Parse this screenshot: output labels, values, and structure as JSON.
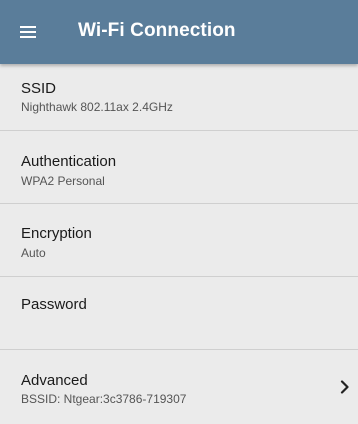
{
  "appbar": {
    "menu_icon": "hamburger-menu-icon",
    "title": "Wi-Fi Connection",
    "color": "#5a7d9a"
  },
  "settings": {
    "ssid": {
      "label": "SSID",
      "value": "Nighthawk 802.11ax 2.4GHz"
    },
    "authentication": {
      "label": "Authentication",
      "value": "WPA2 Personal"
    },
    "encryption": {
      "label": "Encryption",
      "value": "Auto"
    },
    "password": {
      "label": "Password",
      "value": ""
    },
    "advanced": {
      "label": "Advanced",
      "value": "BSSID:  Ntgear:3c3786-719307",
      "icon": "chevron-right-icon"
    }
  }
}
